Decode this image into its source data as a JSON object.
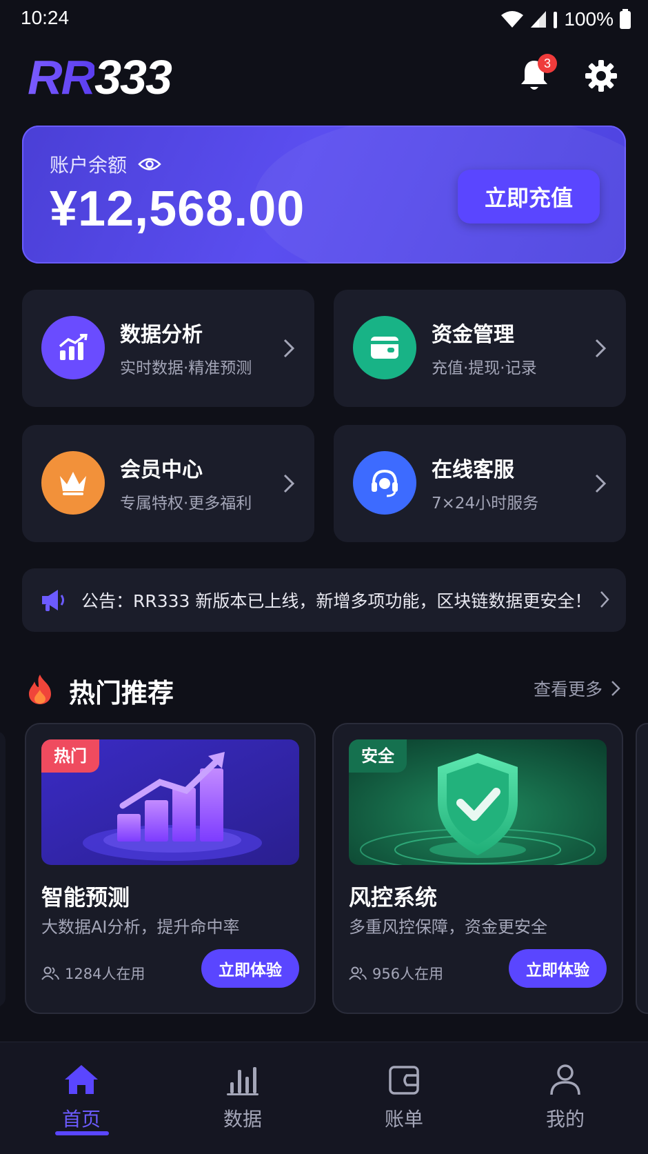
{
  "status_bar": {
    "time": "10:24",
    "battery": "100%"
  },
  "header": {
    "logo_prefix": "RR",
    "logo_suffix": "333",
    "notification_count": "3"
  },
  "balance": {
    "label": "账户余额",
    "amount": "¥12,568.00",
    "recharge_label": "立即充值"
  },
  "features": [
    {
      "title": "数据分析",
      "subtitle": "实时数据·精准预测",
      "icon": "chart-icon",
      "color": "#6a4cff"
    },
    {
      "title": "资金管理",
      "subtitle": "充值·提现·记录",
      "icon": "wallet-icon",
      "color": "#18b386"
    },
    {
      "title": "会员中心",
      "subtitle": "专属特权·更多福利",
      "icon": "crown-icon",
      "color": "#f2913a"
    },
    {
      "title": "在线客服",
      "subtitle": "7×24小时服务",
      "icon": "headset-icon",
      "color": "#3d6bff"
    }
  ],
  "notice": {
    "text": "公告：RR333 新版本已上线，新增多项功能，区块链数据更安全！"
  },
  "section": {
    "title": "热门推荐",
    "more_label": "查看更多"
  },
  "cards": [
    {
      "tag": "热门",
      "tag_color": "#ef4b5f",
      "title": "智能预测",
      "subtitle": "大数据AI分析，提升命中率",
      "users": "1284人在用",
      "button": "立即体验"
    },
    {
      "tag": "安全",
      "tag_color": "#15714f",
      "title": "风控系统",
      "subtitle": "多重风控保障，资金更安全",
      "users": "956人在用",
      "button": "立即体验"
    }
  ],
  "nav": [
    {
      "label": "首页",
      "icon": "home-icon",
      "active": true
    },
    {
      "label": "数据",
      "icon": "bar-chart-icon",
      "active": false
    },
    {
      "label": "账单",
      "icon": "wallet-icon",
      "active": false
    },
    {
      "label": "我的",
      "icon": "user-icon",
      "active": false
    }
  ],
  "colors": {
    "accent": "#5a46ff",
    "background": "#0f1018",
    "tile": "#1b1d2a"
  }
}
